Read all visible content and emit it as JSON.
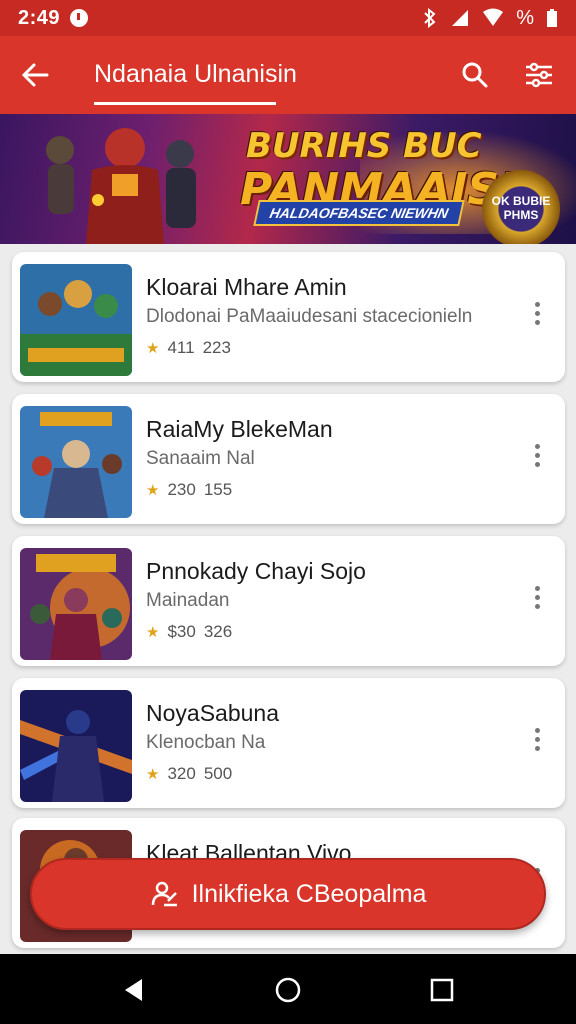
{
  "status_bar": {
    "time": "2:49",
    "battery": "%"
  },
  "app_bar": {
    "title": "Ndanaia Ulnanisin"
  },
  "banner": {
    "line1": "BURIHS BUC",
    "line2": "PANMAAISI",
    "ribbon": "HALDAOFBASEC NIEWHN",
    "badge_text": "OK BUBIE PHMS"
  },
  "items": [
    {
      "title": "Kloarai Mhare Amin",
      "subtitle": "Dlodonai PaMaaiudesani stacecionieln",
      "rating": "411",
      "count": "223"
    },
    {
      "title": "RaiaMy BlekeMan",
      "subtitle": "Sanaaim Nal",
      "rating": "230",
      "count": "155"
    },
    {
      "title": "Pnnokady Chayi Sojo",
      "subtitle": "Mainadan",
      "rating": "$30",
      "count": "326"
    },
    {
      "title": "NoyaSabuna",
      "subtitle": "Klenocban Na",
      "rating": "320",
      "count": "500"
    },
    {
      "title": "Kleat Ballentan Vivo",
      "subtitle": "",
      "rating": "",
      "count": ""
    }
  ],
  "fab": {
    "label": "Ilnikfieka CBeopalma"
  },
  "colors": {
    "primary": "#d9352b",
    "status": "#c62a22",
    "star": "#e0a41c"
  }
}
